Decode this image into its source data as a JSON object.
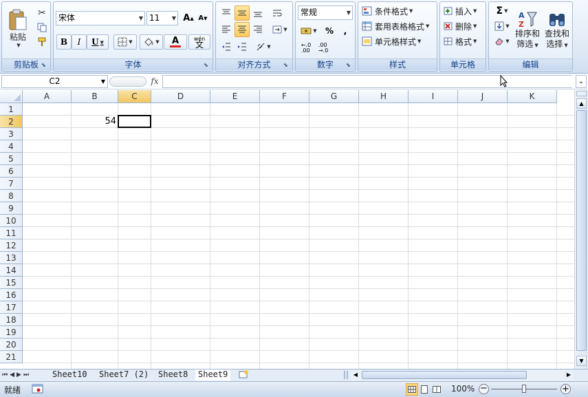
{
  "ribbon": {
    "clipboard": {
      "label": "剪贴板",
      "paste": "粘贴"
    },
    "font": {
      "label": "字体",
      "name": "宋体",
      "size": "11",
      "bold": "B",
      "italic": "I",
      "underline": "U",
      "grow": "A",
      "shrink": "A",
      "phonetic_top": "wén",
      "phonetic": "文",
      "font_color_glyph": "A"
    },
    "alignment": {
      "label": "对齐方式"
    },
    "number": {
      "label": "数字",
      "format": "常规",
      "percent": "%",
      "comma": ",",
      "inc_decimal": "←.0\n.00",
      "dec_decimal": ".00\n→.0"
    },
    "styles": {
      "label": "样式",
      "conditional": "条件格式",
      "table": "套用表格格式",
      "cell": "单元格样式"
    },
    "cells": {
      "label": "单元格",
      "insert": "插入",
      "delete": "删除",
      "format": "格式"
    },
    "editing": {
      "label": "编辑",
      "sum": "Σ",
      "sort_line1": "排序和",
      "sort_line2": "筛选",
      "find_line1": "查找和",
      "find_line2": "选择"
    }
  },
  "formula_bar": {
    "name_box": "C2",
    "fx": "fx",
    "content": ""
  },
  "grid": {
    "columns": [
      "A",
      "B",
      "C",
      "D",
      "E",
      "F",
      "G",
      "H",
      "I",
      "J",
      "K"
    ],
    "rows": [
      "1",
      "2",
      "3",
      "4",
      "5",
      "6",
      "7",
      "8",
      "9",
      "10",
      "11",
      "12",
      "13",
      "14",
      "15",
      "16",
      "17",
      "18",
      "19",
      "20",
      "21"
    ],
    "cells": [
      {
        "ref": "B2",
        "value": "54"
      }
    ],
    "selected_cell": "C2"
  },
  "sheets": {
    "tabs": [
      "Sheet10",
      "Sheet7 (2)",
      "Sheet8",
      "Sheet9"
    ],
    "active": "Sheet9"
  },
  "status_bar": {
    "mode": "就绪",
    "zoom": "100%",
    "zoom_out": "−",
    "zoom_in": "+"
  },
  "colors": {
    "accent": "#15428b",
    "selected": "#fcc95f",
    "grid": "#dadcdd"
  }
}
